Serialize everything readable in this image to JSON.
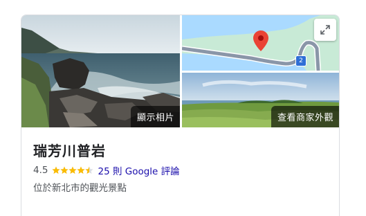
{
  "place": {
    "name": "瑞芳川普岩",
    "rating": "4.5",
    "rating_value": 4.5,
    "rating_max": 5,
    "reviews_link": "25 則 Google 評論",
    "category": "位於新北市的觀光景點"
  },
  "photos": {
    "show_photos_label": "顯示相片",
    "view_outside_label": "查看商家外觀"
  },
  "map": {
    "route_number": "2",
    "pin_icon": "location-pin-icon",
    "expand_icon": "expand-icon"
  },
  "colors": {
    "star": "#fbbc04",
    "pin": "#ea4335",
    "link": "#1a0dab",
    "map_water": "#aadaff",
    "map_land": "#c8ead6"
  }
}
